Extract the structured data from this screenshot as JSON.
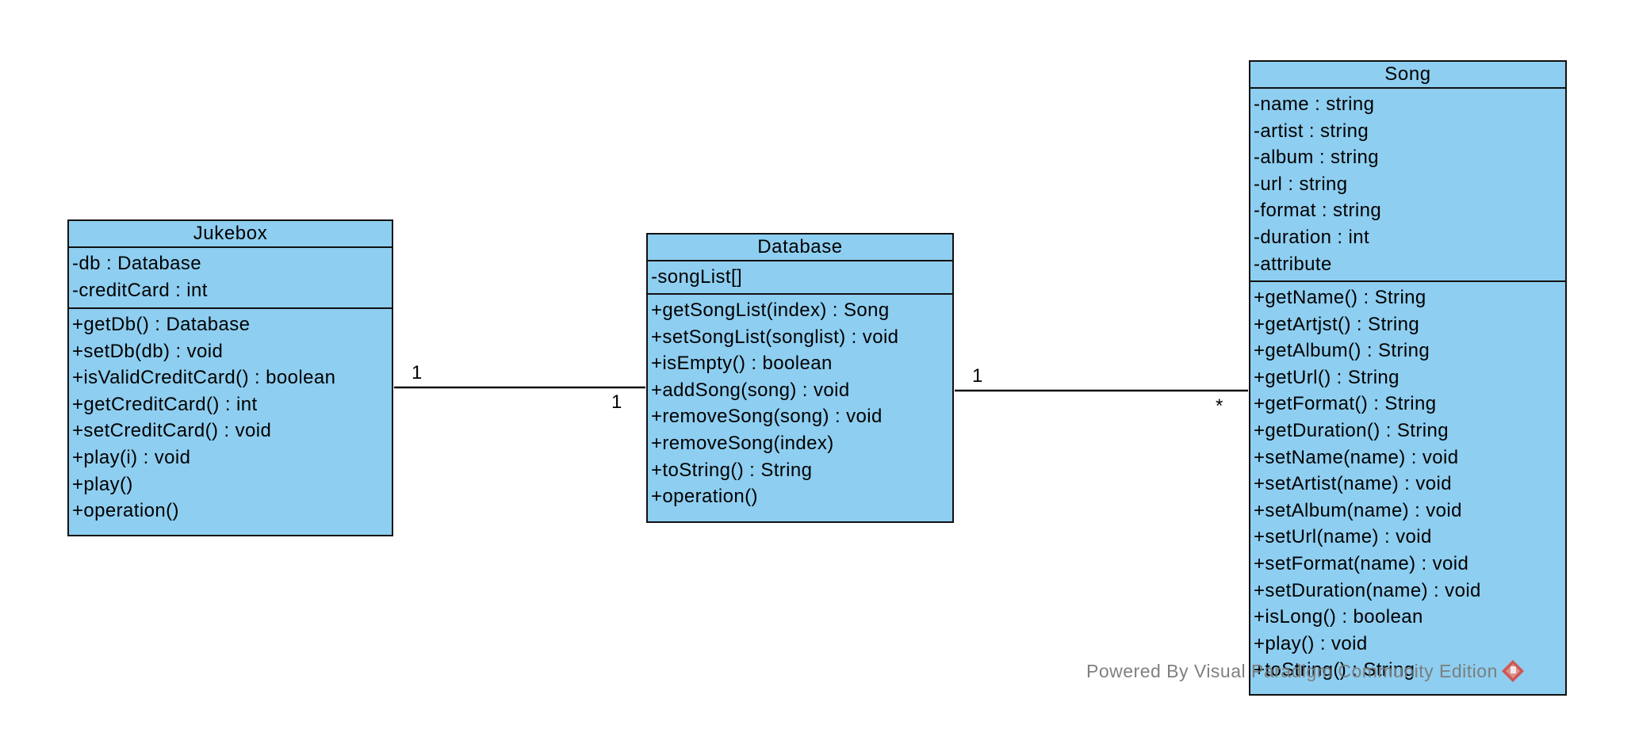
{
  "diagram": {
    "type": "UML class diagram",
    "colors": {
      "class_fill": "#8ecef0",
      "class_border": "#111111",
      "connector": "#111111",
      "watermark_text": "#7a7a7a",
      "watermark_logo": "#d9443a"
    },
    "classes": [
      {
        "id": "jukebox",
        "name": "Jukebox",
        "attributes": [
          "-db : Database",
          "-creditCard : int"
        ],
        "operations": [
          "+getDb() : Database",
          "+setDb(db) : void",
          "+isValidCreditCard() : boolean",
          "+getCreditCard() : int",
          "+setCreditCard() : void",
          "+play(i) : void",
          "+play()",
          "+operation()"
        ]
      },
      {
        "id": "database",
        "name": "Database",
        "attributes": [
          "-songList[]"
        ],
        "operations": [
          "+getSongList(index) : Song",
          "+setSongList(songlist) : void",
          "+isEmpty() : boolean",
          "+addSong(song) : void",
          "+removeSong(song) : void",
          "+removeSong(index)",
          "+toString() : String",
          "+operation()"
        ]
      },
      {
        "id": "song",
        "name": "Song",
        "attributes": [
          "-name : string",
          "-artist : string",
          "-album : string",
          "-url : string",
          "-format : string",
          "-duration : int",
          "-attribute"
        ],
        "operations": [
          "+getName() : String",
          "+getArtjst() : String",
          "+getAlbum() : String",
          "+getUrl() : String",
          "+getFormat() : String",
          "+getDuration() : String",
          "+setName(name) : void",
          "+setArtist(name) : void",
          "+setAlbum(name) : void",
          "+setUrl(name) : void",
          "+setFormat(name) : void",
          "+setDuration(name) : void",
          "+isLong() : boolean",
          "+play() : void",
          "+toString() : String"
        ]
      }
    ],
    "associations": [
      {
        "from": "Jukebox",
        "to": "Database",
        "from_multiplicity": "1",
        "to_multiplicity": "1"
      },
      {
        "from": "Database",
        "to": "Song",
        "from_multiplicity": "1",
        "to_multiplicity": "*"
      }
    ]
  },
  "watermark": {
    "text": "Powered By Visual Paradigm Community Edition",
    "icon": "visual-paradigm-logo-icon"
  }
}
